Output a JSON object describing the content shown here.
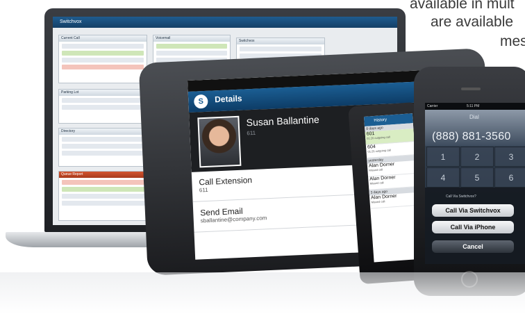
{
  "marketing": {
    "line1": "available in mult",
    "line2": "are available",
    "line3": "mes"
  },
  "laptop": {
    "app_title": "Switchvox",
    "panels": [
      {
        "title": "Current Call"
      },
      {
        "title": "Voicemail"
      },
      {
        "title": "Switchvox"
      },
      {
        "title": "Parking Lot"
      },
      {
        "title": "Directory"
      },
      {
        "title": "Queue Report"
      }
    ]
  },
  "tablet": {
    "header_logo": "S",
    "header_title": "Details",
    "contact_name": "Susan Ballantine",
    "contact_ext": "611",
    "items": [
      {
        "title": "Call Extension",
        "value": "611"
      },
      {
        "title": "Send Email",
        "value": "sballantine@company.com"
      }
    ]
  },
  "android": {
    "header": "History",
    "sections": [
      {
        "label": "8 days ago",
        "rows": [
          {
            "name": "601",
            "sub": "01:20 outgoing call",
            "highlight": true
          },
          {
            "name": "604",
            "sub": "01:25 outgoing call",
            "highlight": false
          }
        ]
      },
      {
        "label": "yesterday",
        "rows": [
          {
            "name": "Alan Dorner",
            "sub": "Missed call",
            "highlight": false
          },
          {
            "name": "Alan Dorner",
            "sub": "Missed call",
            "highlight": false
          }
        ]
      },
      {
        "label": "3 days ago",
        "rows": [
          {
            "name": "Alan Dorner",
            "sub": "Missed call",
            "highlight": false
          }
        ]
      }
    ]
  },
  "iphone": {
    "status_carrier": "Carrier",
    "status_time": "5:11 PM",
    "dial_label": "Dial",
    "number": "(888) 881-3560",
    "keys": [
      "1",
      "2",
      "3",
      "4",
      "5",
      "6"
    ],
    "sheet_prompt": "Call Via Switchvox?",
    "btn_switchvox": "Call Via Switchvox",
    "btn_iphone": "Call Via iPhone",
    "btn_cancel": "Cancel"
  }
}
